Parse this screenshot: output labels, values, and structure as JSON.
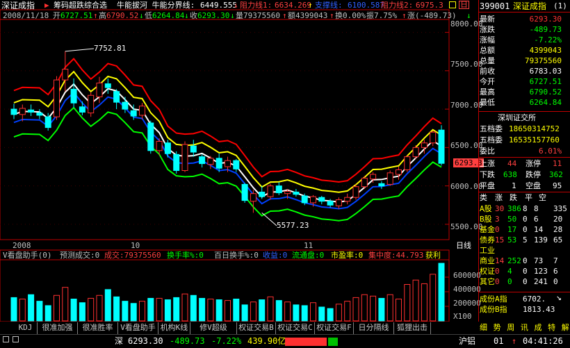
{
  "header": {
    "title": "深证成指",
    "formula": "筹码超跌综合选",
    "indicator_text": "牛能拔河  牛能分界线:",
    "divide_value": "6449.555",
    "r1_label": "阻力线1:",
    "r1_value": "6634.269",
    "support_label": "支撑线:",
    "support_value": "6100.587",
    "r2_label": "阻力线2:",
    "r2_value": "6975.3"
  },
  "info": {
    "date": "2008/11/18",
    "open_label": "开",
    "open": "6727.51",
    "high_label": "高",
    "high": "6790.52",
    "low_label": "低",
    "low": "6264.84",
    "close_label": "收",
    "close": "6293.30",
    "vol_label": "量",
    "vol": "79375560",
    "amt_label": "额",
    "amt": "4399043",
    "turn_label": "换",
    "turn": "0.00%",
    "amp_label": "振",
    "amp": "7.75%",
    "chg_label": "涨",
    "chg": "(-489.73)"
  },
  "main_axis": [
    "8000.00",
    "7500.00",
    "7000.00",
    "6500.00",
    "6000.00",
    "5500.00"
  ],
  "date_labels": [
    "2008",
    "10",
    "11"
  ],
  "period_label": "日线",
  "price_marker": "6293.3",
  "annotations": {
    "high": "7752.81",
    "low": "5577.23"
  },
  "chart_data": {
    "type": "candlestick",
    "ylim": [
      5300,
      8150
    ],
    "candles": [
      {
        "o": 7000,
        "h": 7070,
        "l": 6870,
        "c": 6930
      },
      {
        "o": 6930,
        "h": 7060,
        "l": 6840,
        "c": 7010
      },
      {
        "o": 6990,
        "h": 7060,
        "l": 6910,
        "c": 6960
      },
      {
        "o": 6950,
        "h": 7000,
        "l": 6870,
        "c": 6920
      },
      {
        "o": 6900,
        "h": 6950,
        "l": 6720,
        "c": 6760
      },
      {
        "o": 6900,
        "h": 7430,
        "l": 6860,
        "c": 7380
      },
      {
        "o": 7380,
        "h": 7752.81,
        "l": 7230,
        "c": 7520
      },
      {
        "o": 7260,
        "h": 7400,
        "l": 7020,
        "c": 7080
      },
      {
        "o": 7030,
        "h": 7100,
        "l": 6920,
        "c": 6960
      },
      {
        "o": 6950,
        "h": 7220,
        "l": 6900,
        "c": 7180
      },
      {
        "o": 7160,
        "h": 7420,
        "l": 7080,
        "c": 7340
      },
      {
        "o": 7330,
        "h": 7400,
        "l": 7200,
        "c": 7280
      },
      {
        "o": 7230,
        "h": 7260,
        "l": 7000,
        "c": 7090
      },
      {
        "o": 7090,
        "h": 7160,
        "l": 6950,
        "c": 7000
      },
      {
        "o": 6980,
        "h": 7060,
        "l": 6860,
        "c": 6910
      },
      {
        "o": 6920,
        "h": 7080,
        "l": 6870,
        "c": 7040
      },
      {
        "o": 6820,
        "h": 6850,
        "l": 6420,
        "c": 6460
      },
      {
        "o": 6460,
        "h": 6620,
        "l": 6400,
        "c": 6580
      },
      {
        "o": 6560,
        "h": 6600,
        "l": 6370,
        "c": 6420
      },
      {
        "o": 6410,
        "h": 6450,
        "l": 6160,
        "c": 6200
      },
      {
        "o": 6200,
        "h": 6580,
        "l": 6180,
        "c": 6540
      },
      {
        "o": 6520,
        "h": 6600,
        "l": 6380,
        "c": 6440
      },
      {
        "o": 6380,
        "h": 6410,
        "l": 6240,
        "c": 6290
      },
      {
        "o": 6280,
        "h": 6390,
        "l": 6220,
        "c": 6360
      },
      {
        "o": 6360,
        "h": 6420,
        "l": 6180,
        "c": 6230
      },
      {
        "o": 6250,
        "h": 6380,
        "l": 6180,
        "c": 6330
      },
      {
        "o": 6330,
        "h": 6350,
        "l": 6180,
        "c": 6220
      },
      {
        "o": 6020,
        "h": 6040,
        "l": 5780,
        "c": 5810
      },
      {
        "o": 5800,
        "h": 5950,
        "l": 5650,
        "c": 5900
      },
      {
        "o": 5920,
        "h": 6000,
        "l": 5830,
        "c": 5860
      },
      {
        "o": 5860,
        "h": 6030,
        "l": 5820,
        "c": 6000
      },
      {
        "o": 6000,
        "h": 6050,
        "l": 5880,
        "c": 5910
      },
      {
        "o": 5900,
        "h": 5960,
        "l": 5830,
        "c": 5930
      },
      {
        "o": 5920,
        "h": 5960,
        "l": 5860,
        "c": 5890
      },
      {
        "o": 5870,
        "h": 5900,
        "l": 5750,
        "c": 5780
      },
      {
        "o": 5780,
        "h": 5880,
        "l": 5730,
        "c": 5860
      },
      {
        "o": 5850,
        "h": 5870,
        "l": 5760,
        "c": 5800
      },
      {
        "o": 5800,
        "h": 5830,
        "l": 5720,
        "c": 5750
      },
      {
        "o": 5740,
        "h": 5850,
        "l": 5700,
        "c": 5820
      },
      {
        "o": 5800,
        "h": 5900,
        "l": 5760,
        "c": 5850
      },
      {
        "o": 5850,
        "h": 6020,
        "l": 5820,
        "c": 5990
      },
      {
        "o": 5990,
        "h": 6130,
        "l": 5960,
        "c": 6100
      },
      {
        "o": 6090,
        "h": 6180,
        "l": 6040,
        "c": 6150
      },
      {
        "o": 6030,
        "h": 6060,
        "l": 5960,
        "c": 6000
      },
      {
        "o": 6020,
        "h": 6200,
        "l": 6000,
        "c": 6170
      },
      {
        "o": 6150,
        "h": 6250,
        "l": 6080,
        "c": 6210
      },
      {
        "o": 6210,
        "h": 6400,
        "l": 6180,
        "c": 6380
      },
      {
        "o": 6380,
        "h": 6530,
        "l": 6350,
        "c": 6500
      },
      {
        "o": 6500,
        "h": 6600,
        "l": 6420,
        "c": 6560
      },
      {
        "o": 6560,
        "h": 6720,
        "l": 6520,
        "c": 6700
      },
      {
        "o": 6727.51,
        "h": 6790.52,
        "l": 6264.84,
        "c": 6293.3
      }
    ],
    "volumes": [
      320,
      300,
      360,
      270,
      210,
      350,
      460,
      300,
      250,
      310,
      350,
      430,
      330,
      270,
      240,
      270,
      310,
      310,
      290,
      320,
      370,
      350,
      310,
      300,
      290,
      280,
      300,
      220,
      260,
      290,
      330,
      280,
      260,
      220,
      210,
      250,
      190,
      170,
      230,
      270,
      320,
      360,
      340,
      310,
      360,
      300,
      500,
      560,
      510,
      640,
      790
    ],
    "vol_axis": [
      "600000",
      "400000",
      "200000"
    ],
    "vol_unit": "X100"
  },
  "vol_header": {
    "title": "V看盘助手(0)",
    "fields": [
      {
        "k": "预测成交:",
        "v": "0"
      },
      {
        "k": "成交:",
        "v": "79375560"
      },
      {
        "k": "换手率%:",
        "v": "0"
      },
      {
        "k": "百日换手%:",
        "v": "0"
      },
      {
        "k": "收益:",
        "v": "0"
      },
      {
        "k": "流通盘:",
        "v": "0"
      },
      {
        "k": "市盈率:",
        "v": "0"
      },
      {
        "k": "集中度:",
        "v": "44.793"
      },
      {
        "k": "获利",
        "v": ""
      }
    ]
  },
  "tabs": [
    "KDJ",
    "很准加强",
    "很准胜率",
    "V看盘助手",
    "机构K线",
    "修V超级MACD",
    "权证交易B",
    "权证交易C",
    "权证交易F",
    "日分隔线",
    "狐狸出击"
  ],
  "right_panel": {
    "code": "399001",
    "name": "深证成指",
    "period": "(1)",
    "rows": [
      {
        "k": "最新",
        "v": "6293.30",
        "c": "#ff3232"
      },
      {
        "k": "涨跌",
        "v": "-489.73",
        "c": "#00ff00"
      },
      {
        "k": "涨幅",
        "v": "-7.22%",
        "c": "#00ff00"
      },
      {
        "k": "总额",
        "v": "4399043",
        "c": "#ffff00"
      },
      {
        "k": "总量",
        "v": "79375560",
        "c": "#ffff00"
      },
      {
        "k": "前收",
        "v": "6783.03",
        "c": "#ffffff"
      },
      {
        "k": "今开",
        "v": "6727.51",
        "c": "#00ff00"
      },
      {
        "k": "最高",
        "v": "6790.52",
        "c": "#00ff00"
      },
      {
        "k": "最低",
        "v": "6264.84",
        "c": "#00ff00"
      }
    ],
    "exchange": "深圳证交所",
    "five_bid_label": "五档委",
    "five_bid": "18650314752",
    "five_ask_label": "五档委",
    "five_ask": "16535157760",
    "wb_label": "委比",
    "wb": "6.01%",
    "up_label": "上涨",
    "up": "44",
    "limit_up_label": "涨停",
    "limit_up": "11",
    "down_label": "下跌",
    "down": "638",
    "limit_down_label": "跌停",
    "limit_down": "362",
    "flat_label": "平盘",
    "flat": "1",
    "suspend_label": "空盘",
    "suspend": "95",
    "sector_header": [
      "类",
      "涨",
      "跌",
      "平",
      "空"
    ],
    "sectors": [
      {
        "n": "A股",
        "a": "30",
        "b": "386",
        "c": "8",
        "d": "8",
        "e": "335"
      },
      {
        "n": "B股",
        "a": "3",
        "b": "50",
        "c": "0",
        "d": "6",
        "e": "20"
      },
      {
        "n": "基金",
        "a": "0",
        "b": "17",
        "c": "0",
        "d": "14",
        "e": "28"
      },
      {
        "n": "债券",
        "a": "15",
        "b": "53",
        "c": "5",
        "d": "139",
        "e": "65"
      },
      {
        "n": "工业",
        "a": "",
        "b": "",
        "c": "",
        "d": "",
        "e": ""
      },
      {
        "n": "商业",
        "a": "14",
        "b": "252",
        "c": "0",
        "d": "73",
        "e": "7"
      },
      {
        "n": "权证",
        "a": "0",
        "b": "4",
        "c": "0",
        "d": "123",
        "e": "6"
      },
      {
        "n": "其它",
        "a": "0",
        "b": "0",
        "c": "0",
        "d": "241",
        "e": "0"
      }
    ],
    "idx_a_label": "成份A指",
    "idx_a": "6702.",
    "idx_b_label": "成份B指",
    "idx_b": "1813.43",
    "bottom_tabs": "细 势 周 讯 成 特 解"
  },
  "status": {
    "market": "深",
    "price": "6293.30",
    "chg": "-489.73",
    "pct": "-7.22%",
    "amt": "439.90亿",
    "right_label": "沪铝",
    "right_code": "01",
    "time": "04:41:26"
  }
}
